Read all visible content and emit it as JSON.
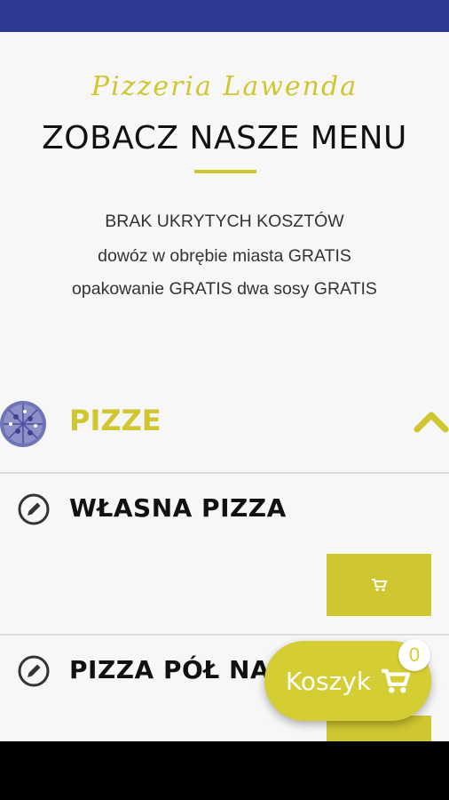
{
  "brand": "Pizzeria Lawenda",
  "heading": "ZOBACZ NASZE MENU",
  "info": {
    "line1": "BRAK UKRYTYCH KOSZTÓW",
    "line2": "dowóz w obrębie miasta GRATIS",
    "line3": "opakowanie GRATIS   dwa sosy GRATIS"
  },
  "category": {
    "label": "PIZZE",
    "icon": "pizza-icon",
    "expanded": true
  },
  "items": [
    {
      "name": "WŁASNA PIZZA",
      "icon": "edit-icon"
    },
    {
      "name": "PIZZA PÓŁ NA PÓŁ",
      "icon": "edit-icon"
    }
  ],
  "cart": {
    "label": "Koszyk",
    "count": "0"
  },
  "colors": {
    "accent": "#cfc630",
    "status_bar": "#2e3a93",
    "background": "#f7f7f7"
  }
}
